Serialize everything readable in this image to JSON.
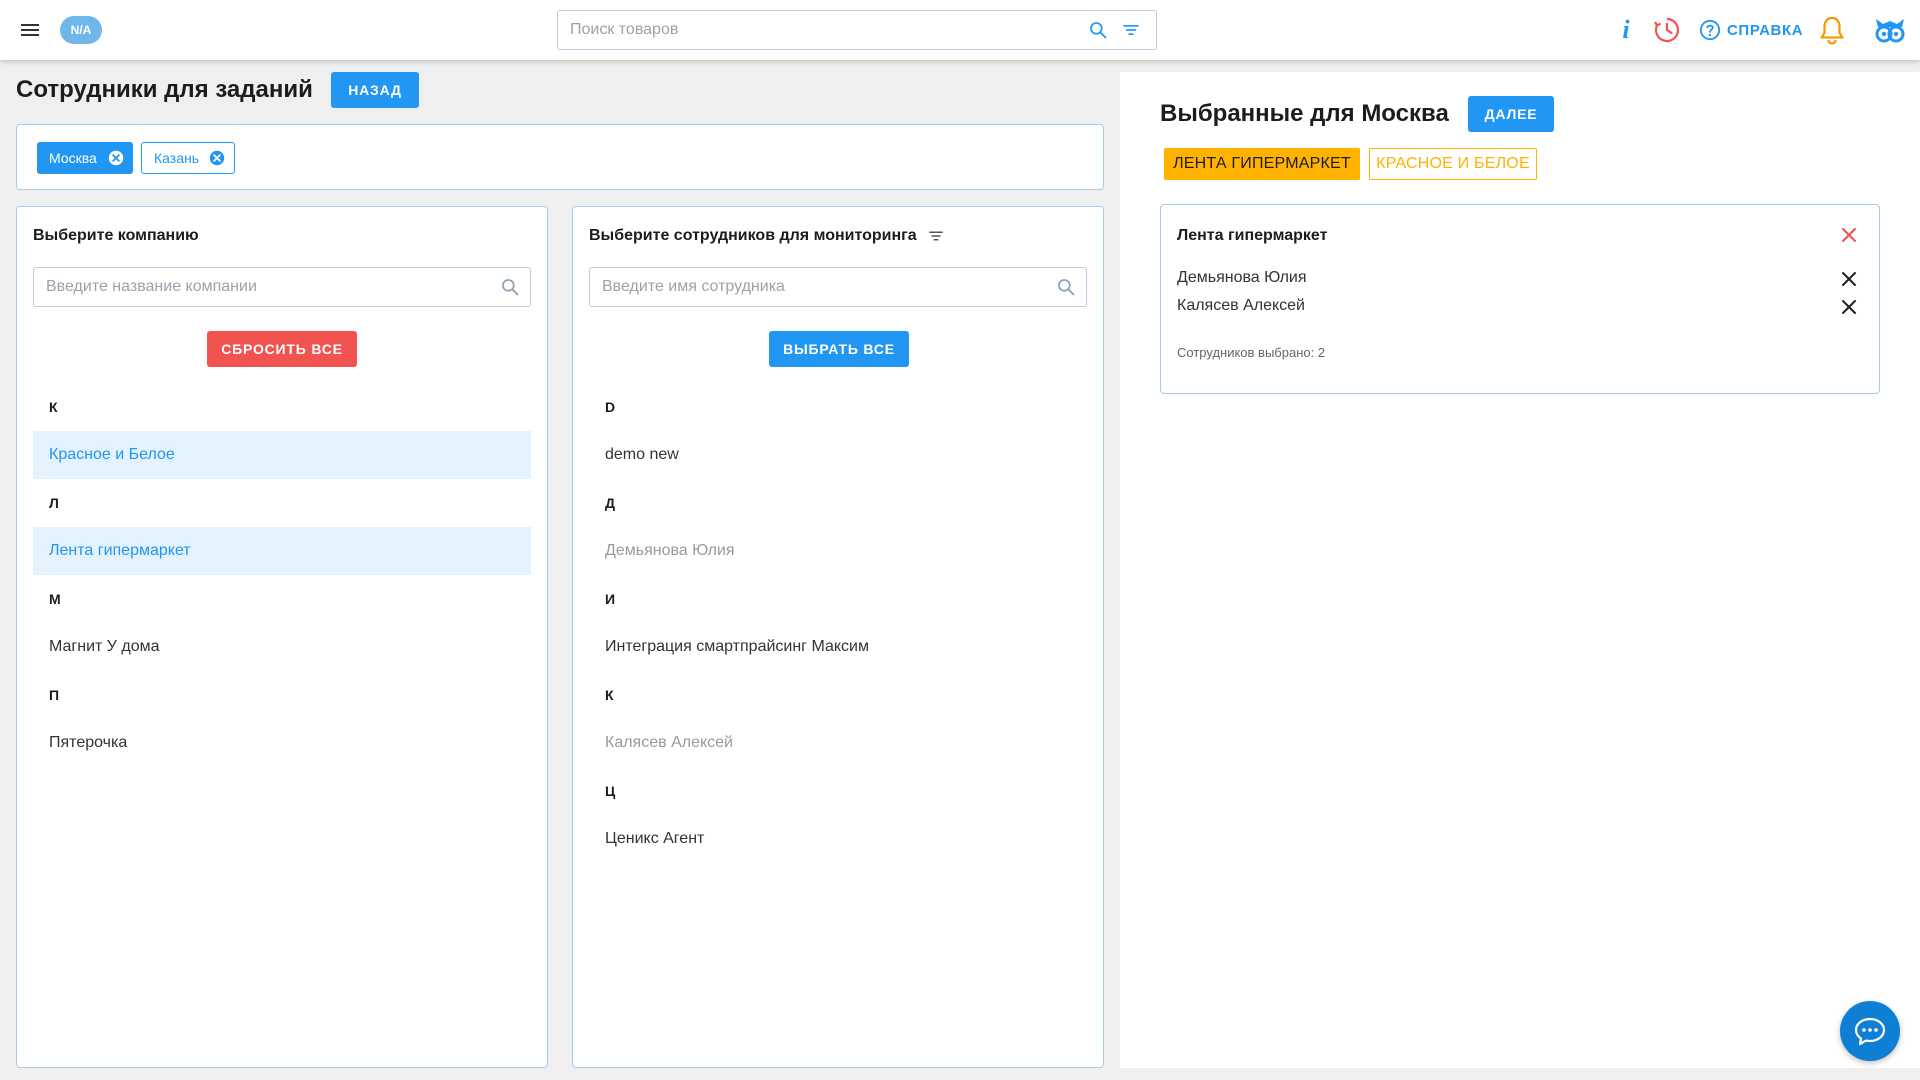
{
  "header": {
    "avatar_text": "N/A",
    "search_placeholder": "Поиск товаров",
    "help_label": "СПРАВКА",
    "info_glyph": "i"
  },
  "page": {
    "title": "Сотрудники для заданий",
    "back_label": "НАЗАД"
  },
  "regions": [
    {
      "label": "Москва",
      "active": true
    },
    {
      "label": "Казань",
      "active": false
    }
  ],
  "company_panel": {
    "title": "Выберите компанию",
    "search_placeholder": "Введите название компании",
    "reset_label": "СБРОСИТЬ ВСЕ",
    "groups": [
      {
        "letter": "К",
        "items": [
          {
            "name": "Красное и Белое",
            "state": "selected"
          }
        ]
      },
      {
        "letter": "Л",
        "items": [
          {
            "name": "Лента гипермаркет",
            "state": "selected"
          }
        ]
      },
      {
        "letter": "М",
        "items": [
          {
            "name": "Магнит У дома",
            "state": "normal"
          }
        ]
      },
      {
        "letter": "П",
        "items": [
          {
            "name": "Пятерочка",
            "state": "normal"
          }
        ]
      }
    ]
  },
  "employee_panel": {
    "title": "Выберите сотрудников для мониторинга",
    "search_placeholder": "Введите имя сотрудника",
    "select_all_label": "ВЫБРАТЬ ВСЕ",
    "groups": [
      {
        "letter": "D",
        "items": [
          {
            "name": "demo new",
            "state": "normal"
          }
        ]
      },
      {
        "letter": "Д",
        "items": [
          {
            "name": "Демьянова Юлия",
            "state": "muted"
          }
        ]
      },
      {
        "letter": "И",
        "items": [
          {
            "name": "Интеграция смартпрайсинг Максим",
            "state": "normal"
          }
        ]
      },
      {
        "letter": "К",
        "items": [
          {
            "name": "Калясев Алексей",
            "state": "muted"
          }
        ]
      },
      {
        "letter": "Ц",
        "items": [
          {
            "name": "Ценикс Агент",
            "state": "normal"
          }
        ]
      }
    ]
  },
  "selected_panel": {
    "title": "Выбранные для Москва",
    "next_label": "ДАЛЕЕ",
    "tabs": [
      {
        "label": "ЛЕНТА ГИПЕРМАРКЕТ",
        "active": true
      },
      {
        "label": "КРАСНОЕ И БЕЛОЕ",
        "active": false
      }
    ],
    "card": {
      "company": "Лента гипермаркет",
      "employees": [
        "Демьянова Юлия",
        "Калясев Алексей"
      ],
      "count_text": "Сотрудников выбрано: 2"
    }
  },
  "colors": {
    "primary": "#2196f3",
    "danger": "#f15350",
    "warning": "#ffb300",
    "selected_bg": "#e3f2fd"
  }
}
